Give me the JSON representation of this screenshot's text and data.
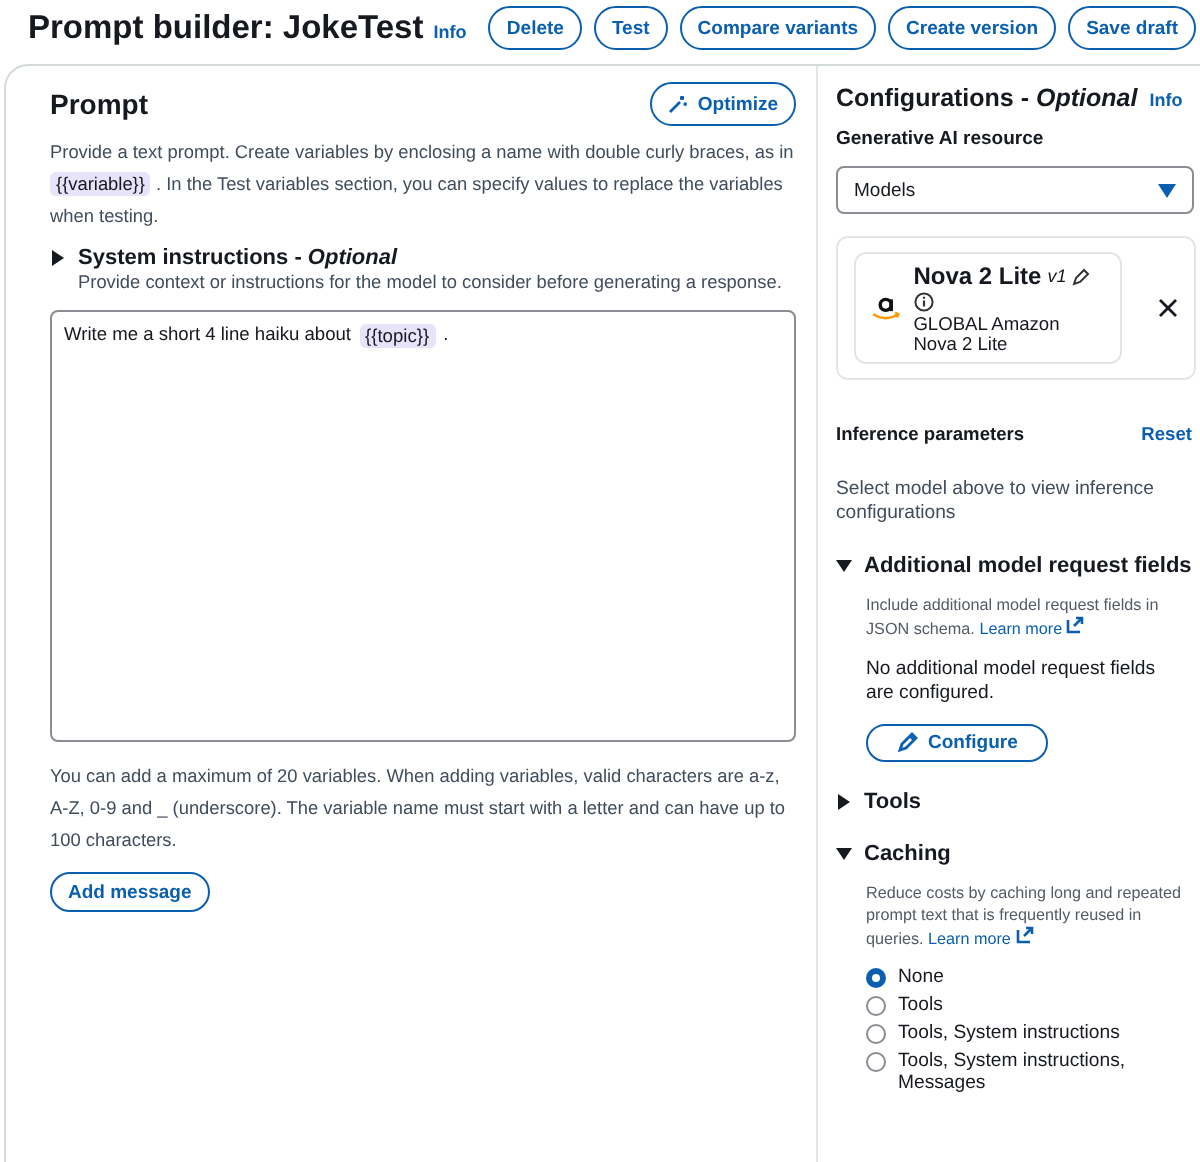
{
  "page": {
    "title": "Prompt builder: JokeTest",
    "info": "Info"
  },
  "header_buttons": [
    "Delete",
    "Test",
    "Compare variants",
    "Create version",
    "Save draft"
  ],
  "prompt": {
    "heading": "Prompt",
    "optimize_button": "Optimize",
    "description": [
      "Provide a text prompt. Create variables by enclosing a name with double curly braces, as in",
      "{{variable}}",
      ". In the Test variables section, you can specify values to replace the variables when testing."
    ],
    "system_instructions": {
      "label": "System instructions - *Optional*",
      "expanded": false,
      "description": "Provide context or instructions for the model to consider before generating a response."
    },
    "editor": {
      "text_before": "Write me a short 4 line haiku about",
      "variable": "{{topic}}",
      "text_after": "."
    },
    "hint": "You can add a maximum of 20 variables. When adding variables, valid characters are a-z, A-Z, 0-9 and _ (underscore). The variable name must start with a letter and can have up to 100 characters.",
    "add_message_button": "Add message"
  },
  "config": {
    "heading": "Configurations - *Optional*",
    "info": "Info",
    "resource_label": "Generative AI resource",
    "resource_select": "Models",
    "model": {
      "name": "Nova 2 Lite",
      "version": "v1",
      "detail": "GLOBAL Amazon Nova 2 Lite"
    },
    "inference": {
      "label": "Inference parameters",
      "reset": "Reset",
      "message": "Select model above to view inference configurations"
    },
    "sections": [
      {
        "kind": "fields",
        "title": "Additional model request fields",
        "expanded": true,
        "description": "Include additional model request fields in JSON schema.",
        "learn_more": "Learn more",
        "message": "No additional model request fields are configured.",
        "button": "Configure"
      },
      {
        "title": "Tools",
        "expanded": false
      },
      {
        "kind": "radios",
        "title": "Caching",
        "expanded": true,
        "description": "Reduce costs by caching long and repeated prompt text that is frequently reused in queries.",
        "learn_more": "Learn more",
        "options": [
          {
            "label": "None",
            "selected": true
          },
          {
            "label": "Tools",
            "selected": false
          },
          {
            "label": "Tools, System instructions",
            "selected": false
          },
          {
            "label": "Tools, System instructions, Messages",
            "selected": false
          }
        ]
      }
    ]
  }
}
